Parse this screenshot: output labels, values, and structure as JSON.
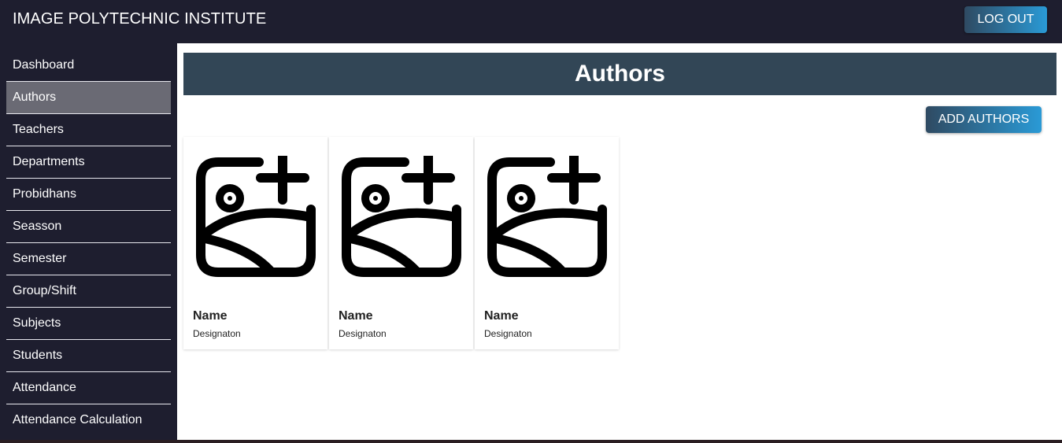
{
  "header": {
    "brand": "IMAGE POLYTECHNIC INSTITUTE",
    "logout_label": "LOG OUT"
  },
  "sidebar": {
    "items": [
      {
        "label": "Dashboard"
      },
      {
        "label": "Authors",
        "active": true
      },
      {
        "label": "Teachers"
      },
      {
        "label": "Departments"
      },
      {
        "label": "Probidhans"
      },
      {
        "label": "Seasson"
      },
      {
        "label": "Semester"
      },
      {
        "label": "Group/Shift"
      },
      {
        "label": "Subjects"
      },
      {
        "label": "Students"
      },
      {
        "label": "Attendance"
      },
      {
        "label": "Attendance Calculation"
      }
    ]
  },
  "main": {
    "title": "Authors",
    "add_label": "ADD AUTHORS",
    "cards": [
      {
        "name": "Name",
        "designation": "Designaton",
        "icon": "add-image-icon"
      },
      {
        "name": "Name",
        "designation": "Designaton",
        "icon": "add-image-icon"
      },
      {
        "name": "Name",
        "designation": "Designaton",
        "icon": "add-image-icon"
      }
    ]
  },
  "colors": {
    "navbar": "#1e1e2f",
    "title_bar": "#324656",
    "active_item": "#6a6a74",
    "button_start": "#2f4a62",
    "button_end": "#2a9ad6"
  }
}
